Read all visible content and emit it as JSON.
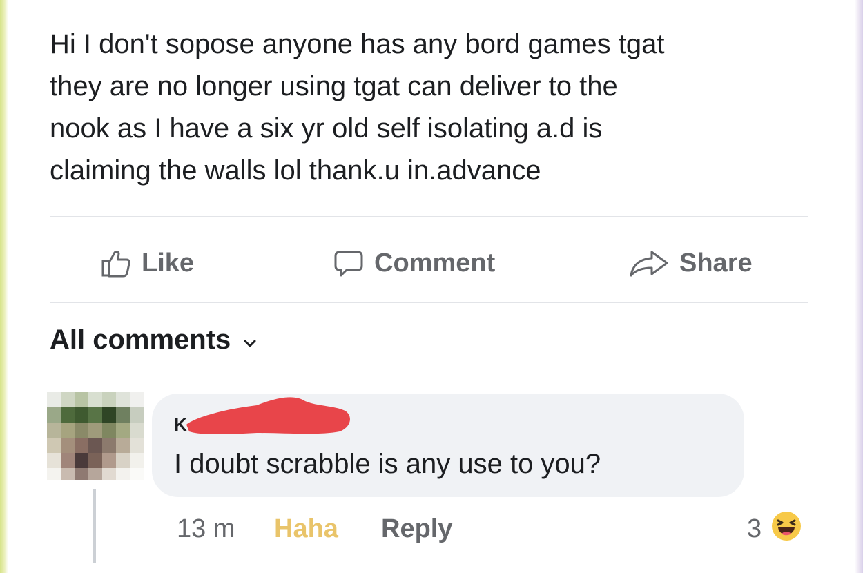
{
  "post": {
    "text": "Hi I don't sopose anyone has any bord games tgat\nthey are no longer using tgat can deliver to the\nnook as I have a six yr old self isolating a.d is\nclaiming the walls lol  thank.u in.advance"
  },
  "actions": {
    "like_label": "Like",
    "comment_label": "Comment",
    "share_label": "Share",
    "icon_color": "#65676b"
  },
  "comments_filter": {
    "label": "All comments"
  },
  "comment": {
    "author_visible": "K",
    "author_redacted": true,
    "redaction_color": "#e8454a",
    "text": "I doubt scrabble is any use to you?",
    "time": "13 m",
    "reaction_label": "Haha",
    "reaction_color": "#e9c46a",
    "reply_label": "Reply",
    "reaction_count": "3",
    "reaction_icon": "haha-emoji-icon"
  }
}
